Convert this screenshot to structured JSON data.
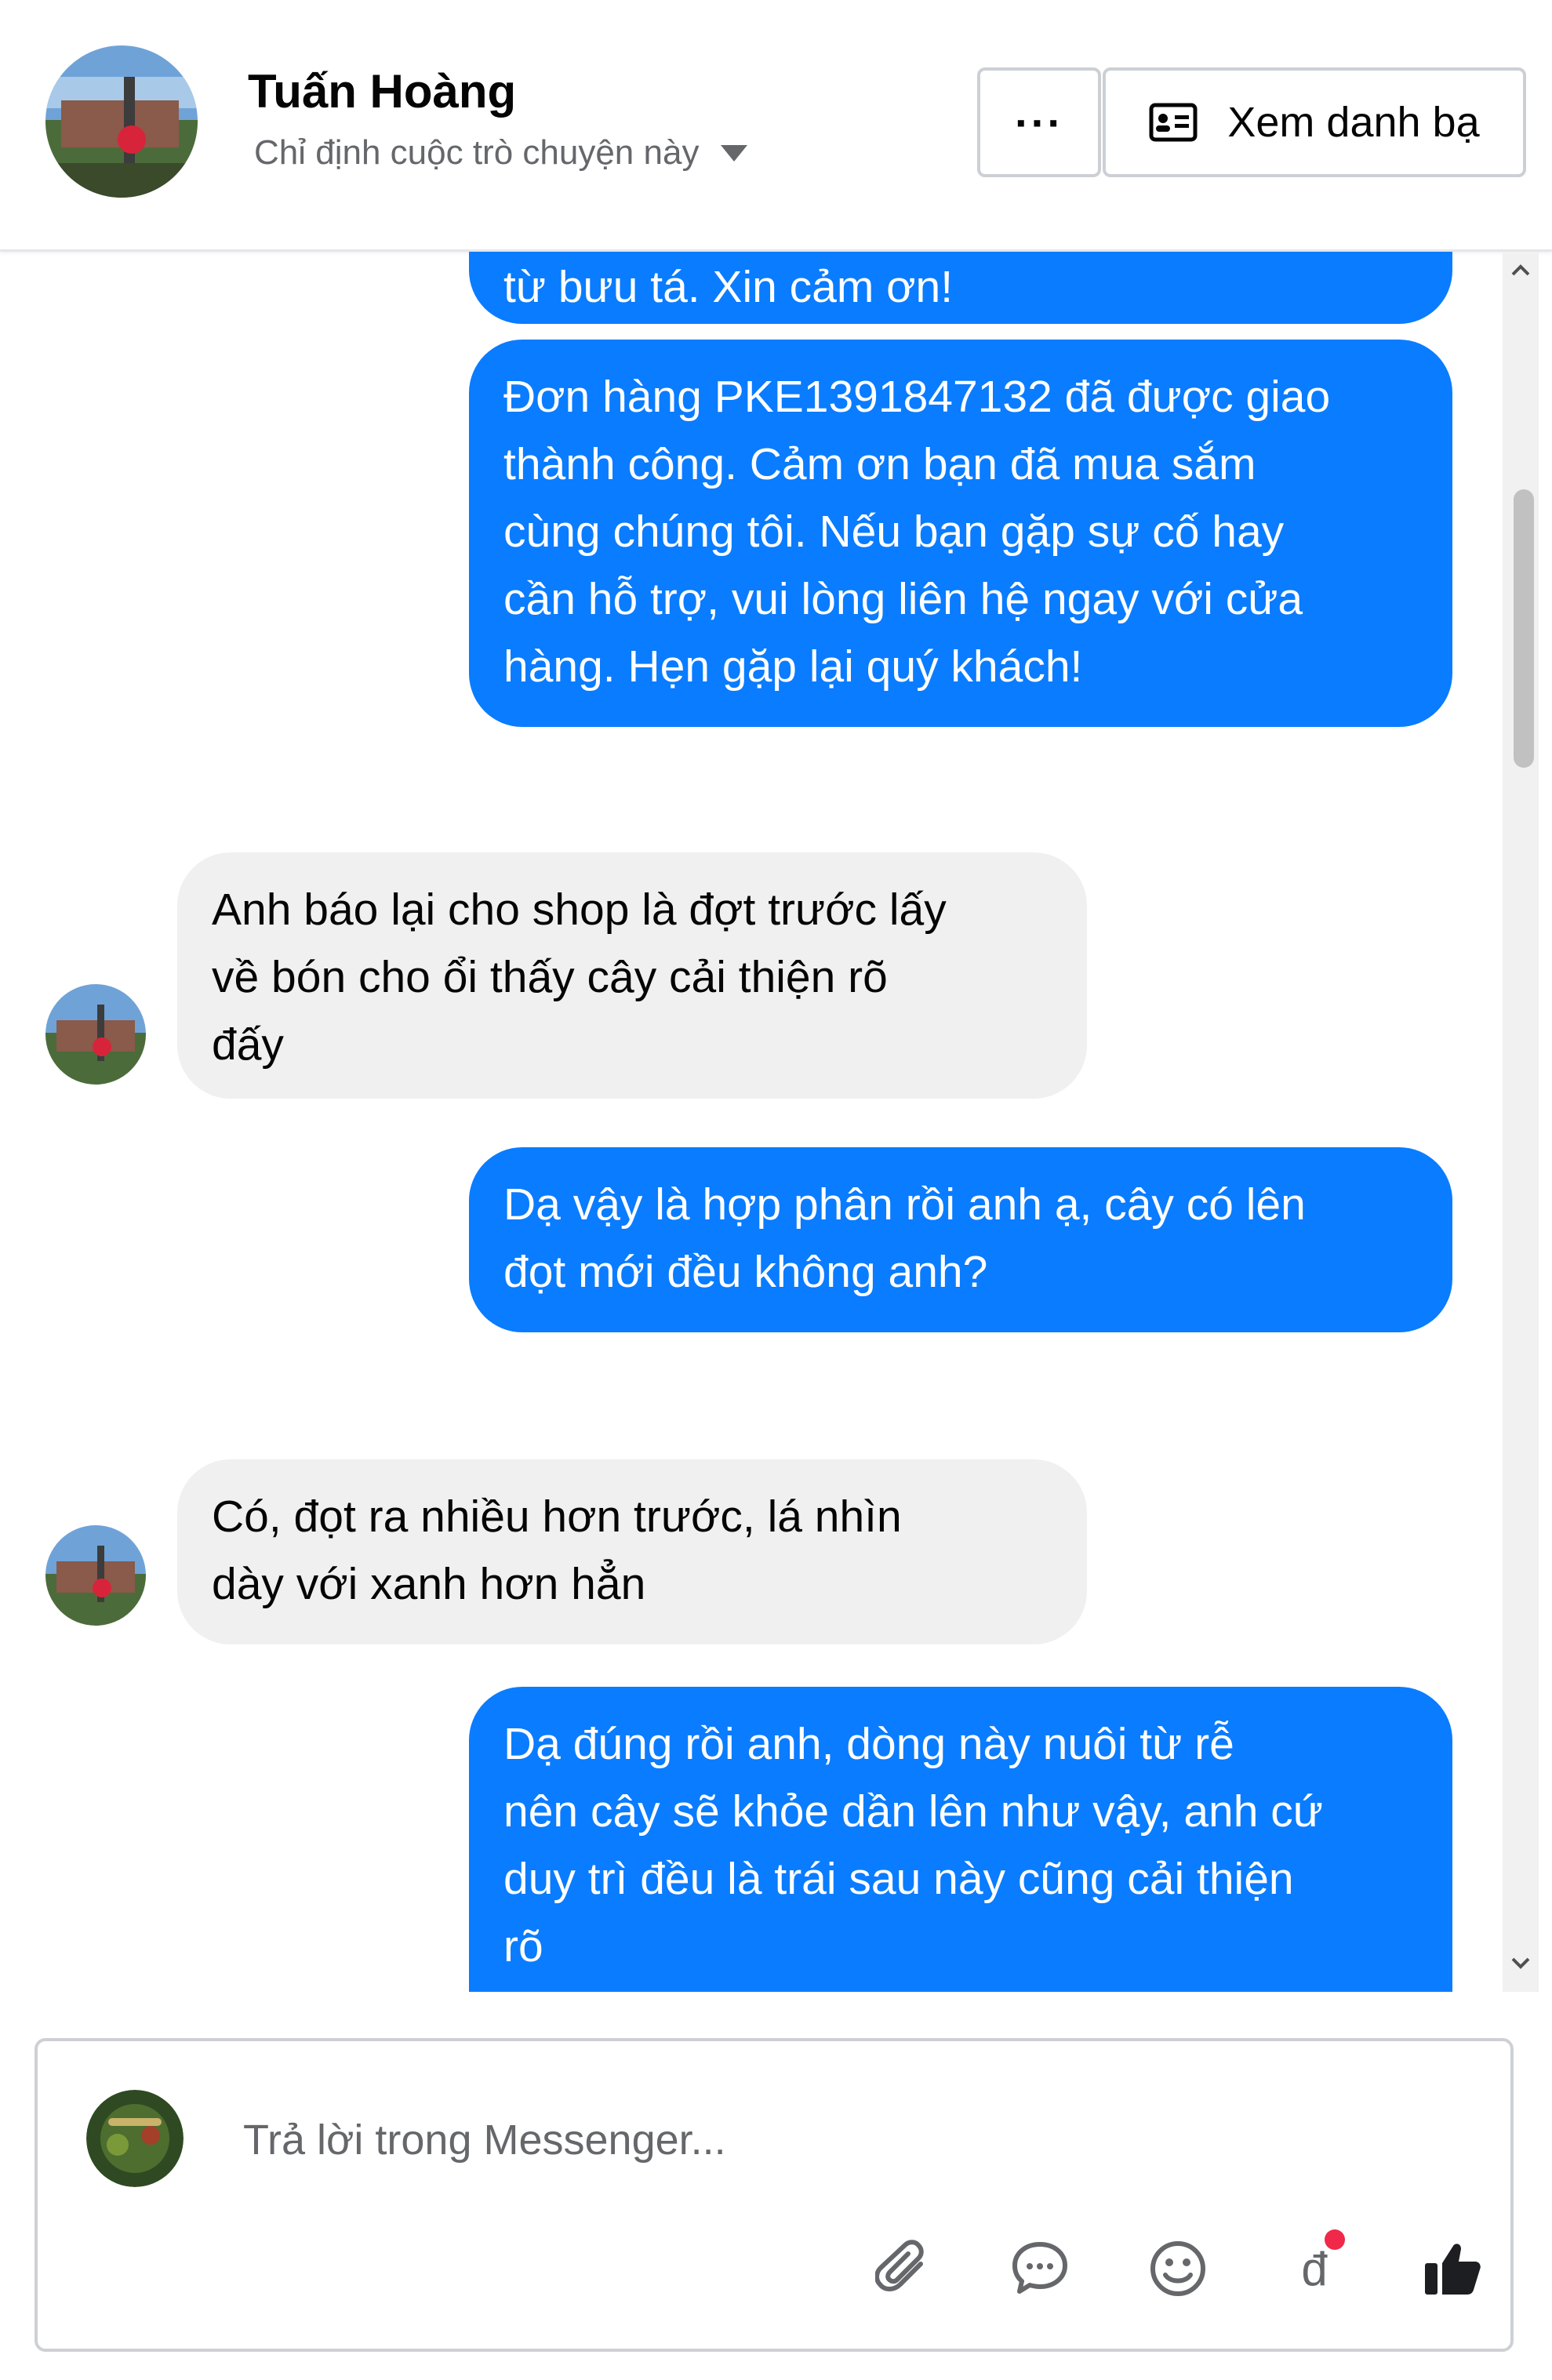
{
  "header": {
    "name": "Tuấn Hoàng",
    "assign_label": "Chỉ định cuộc trò chuyện này",
    "more_label": "···",
    "view_contacts_label": "Xem danh bạ"
  },
  "messages": [
    {
      "direction": "out",
      "text": "từ bưu tá. Xin cảm ơn!"
    },
    {
      "direction": "out",
      "lines": [
        "Đơn hàng PKE1391847132 đã được giao",
        "thành công. Cảm ơn bạn đã mua sắm",
        "cùng chúng tôi. Nếu bạn gặp sự cố hay",
        "cần hỗ trợ, vui lòng liên hệ ngay với cửa",
        "hàng. Hẹn gặp lại quý khách!"
      ]
    },
    {
      "direction": "in",
      "lines": [
        "Anh báo lại cho shop là đợt trước lấy",
        "về bón cho ổi thấy cây cải thiện rõ",
        "đấy"
      ]
    },
    {
      "direction": "out",
      "lines": [
        "Dạ vậy là hợp phân rồi anh ạ, cây có lên",
        "đọt mới đều không anh?"
      ]
    },
    {
      "direction": "in",
      "lines": [
        "Có, đọt ra nhiều hơn trước, lá nhìn",
        "dày với xanh hơn hẳn"
      ]
    },
    {
      "direction": "out",
      "lines": [
        "Dạ đúng rồi anh, dòng này nuôi từ rễ",
        "nên cây sẽ khỏe dần lên như vậy, anh cứ",
        "duy trì đều là trái sau này cũng cải thiện",
        "rõ"
      ]
    }
  ],
  "composer": {
    "placeholder": "Trả lời trong Messenger...",
    "currency_symbol": "đ",
    "tools": [
      "paperclip-icon",
      "chat-bubble-icon",
      "emoji-icon",
      "currency-icon",
      "thumbs-up-icon"
    ],
    "accent_color": "#0a7cff",
    "notification_dot_color": "#f02849"
  },
  "colors": {
    "outgoing_bubble": "#0a7cff",
    "incoming_bubble": "#f0f0f0"
  }
}
